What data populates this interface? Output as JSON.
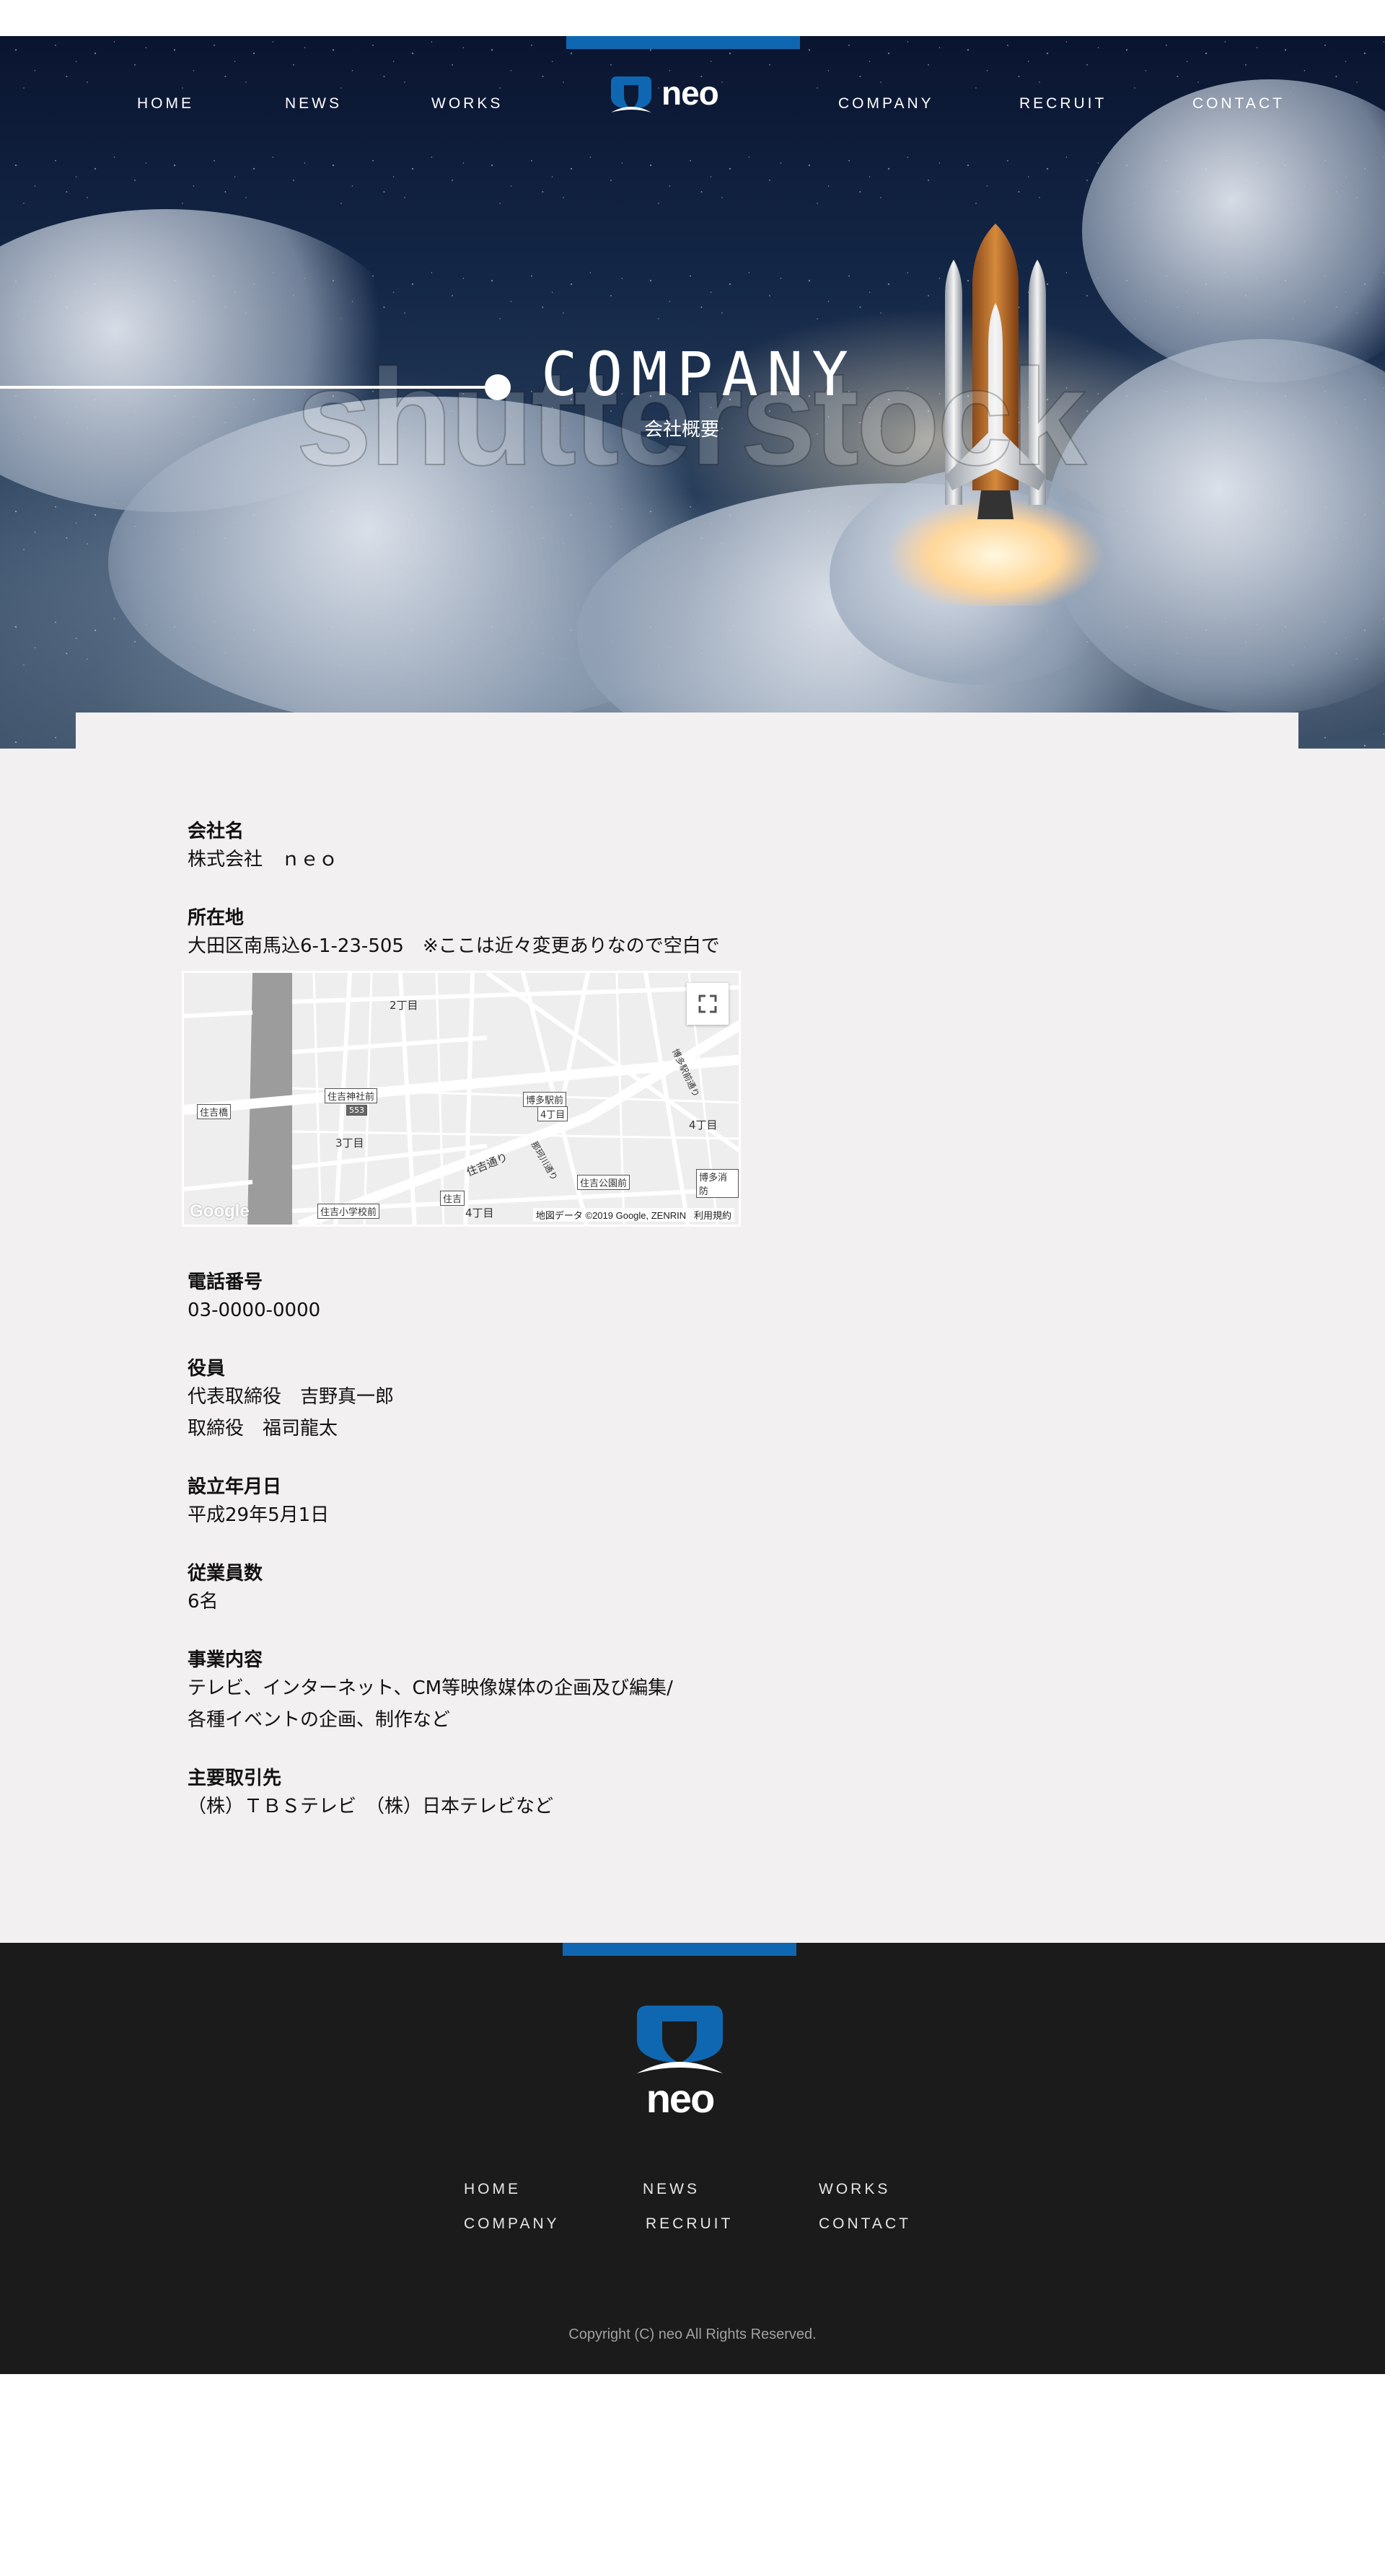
{
  "nav": {
    "items": [
      {
        "label": "HOME"
      },
      {
        "label": "NEWS"
      },
      {
        "label": "WORKS"
      },
      {
        "label": "COMPANY"
      },
      {
        "label": "RECRUIT"
      },
      {
        "label": "CONTACT"
      }
    ]
  },
  "logo": {
    "text": "neo"
  },
  "hero": {
    "title": "COMPANY",
    "subtitle": "会社概要",
    "watermark": "shutterstock"
  },
  "company": [
    {
      "label": "会社名",
      "lines": [
        "株式会社　ｎｅｏ"
      ]
    },
    {
      "label": "所在地",
      "lines": [
        "大田区南馬込6-1-23-505　※ここは近々変更ありなので空白で"
      ]
    },
    {
      "label": "電話番号",
      "lines": [
        "03-0000-0000"
      ]
    },
    {
      "label": "役員",
      "lines": [
        "代表取締役　吉野真一郎",
        "取締役　福司龍太"
      ]
    },
    {
      "label": "設立年月日",
      "lines": [
        "平成29年5月1日"
      ]
    },
    {
      "label": "従業員数",
      "lines": [
        "6名"
      ]
    },
    {
      "label": "事業内容",
      "lines": [
        "テレビ、インターネット、CM等映像媒体の企画及び編集/",
        "各種イベントの企画、制作など"
      ]
    },
    {
      "label": "主要取引先",
      "lines": [
        "（株）ＴＢＳテレビ　（株）日本テレビなど"
      ]
    }
  ],
  "map": {
    "attribution": "地図データ ©2019 Google, ZENRIN",
    "terms": "利用規約",
    "google": "Google",
    "labels": [
      "2丁目",
      "住吉神社前",
      "住吉橋",
      "3丁目",
      "博多駅前",
      "4丁目",
      "4丁目",
      "住吉公園前",
      "住吉小学校前",
      "住吉",
      "4丁目",
      "博多消防",
      "住吉通り",
      "那珂川通り",
      "博多駅前通り",
      "553"
    ]
  },
  "footer": {
    "nav": [
      {
        "label": "HOME"
      },
      {
        "label": "NEWS"
      },
      {
        "label": "WORKS"
      },
      {
        "label": "COMPANY"
      },
      {
        "label": "RECRUIT"
      },
      {
        "label": "CONTACT"
      }
    ],
    "copyright": "Copyright (C) neo All Rights Reserved."
  },
  "colors": {
    "accent": "#0f67b1",
    "main_bg": "#f2f0f1",
    "footer_bg": "#1b1b1b"
  }
}
